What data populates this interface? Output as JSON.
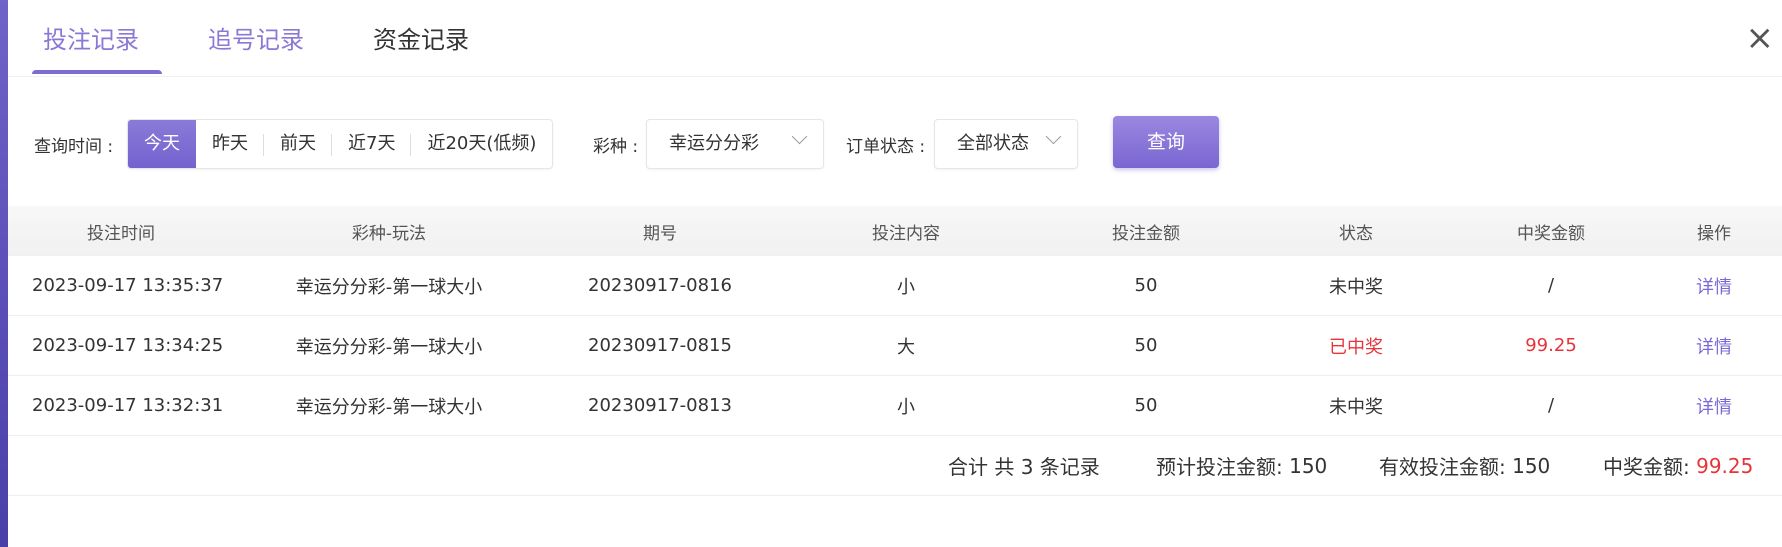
{
  "tabs": [
    {
      "label": "投注记录",
      "active": true
    },
    {
      "label": "追号记录",
      "active": false
    },
    {
      "label": "资金记录",
      "active": false
    }
  ],
  "close_icon": "×",
  "filters": {
    "time_label": "查询时间 :",
    "time_options": [
      "今天",
      "昨天",
      "前天",
      "近7天",
      "近20天(低频)"
    ],
    "time_selected": "今天",
    "lottery_label": "彩种 :",
    "lottery_value": "幸运分分彩",
    "status_label": "订单状态 :",
    "status_value": "全部状态",
    "query_button": "查询"
  },
  "table": {
    "headers": [
      "投注时间",
      "彩种-玩法",
      "期号",
      "投注内容",
      "投注金额",
      "状态",
      "中奖金额",
      "操作"
    ],
    "rows": [
      {
        "time": "2023-09-17 13:35:37",
        "game": "幸运分分彩-第一球大小",
        "issue": "20230917-0816",
        "content": "小",
        "amount": "50",
        "status": "未中奖",
        "prize": "/",
        "action": "详情"
      },
      {
        "time": "2023-09-17 13:34:25",
        "game": "幸运分分彩-第一球大小",
        "issue": "20230917-0815",
        "content": "大",
        "amount": "50",
        "status": "已中奖",
        "prize": "99.25",
        "action": "详情"
      },
      {
        "time": "2023-09-17 13:32:31",
        "game": "幸运分分彩-第一球大小",
        "issue": "20230917-0813",
        "content": "小",
        "amount": "50",
        "status": "未中奖",
        "prize": "/",
        "action": "详情"
      }
    ]
  },
  "summary": {
    "total": "合计 共 3 条记录",
    "estimated_label": "预计投注金额:",
    "estimated_value": "150",
    "valid_label": "有效投注金额:",
    "valid_value": "150",
    "win_label": "中奖金额:",
    "win_value": "99.25"
  },
  "colors": {
    "accent": "#7e6bd4",
    "won": "#e8333a"
  }
}
